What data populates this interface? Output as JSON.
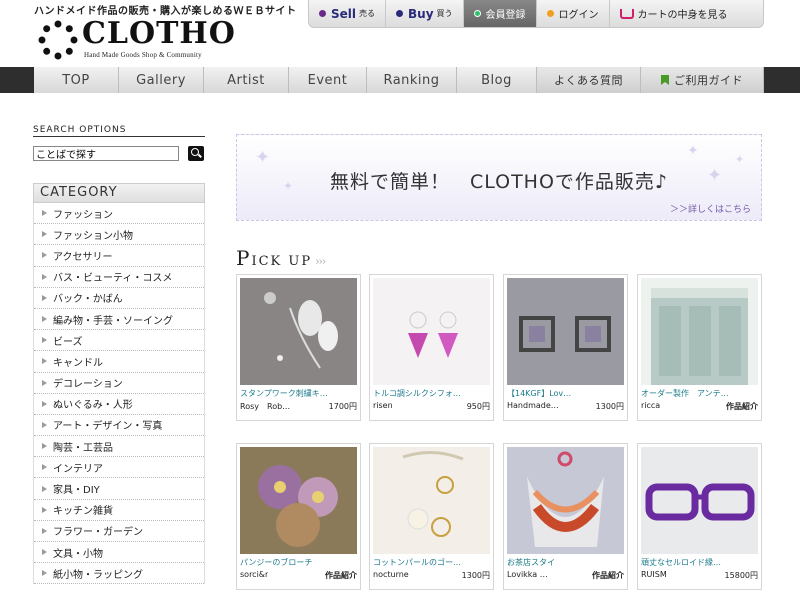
{
  "header": {
    "tagline": "ハンドメイド作品の販売・購入が楽しめるＷＥＢサイト",
    "logo_text": "CLOTHO",
    "logo_sub": "Hand Made Goods Shop & Community"
  },
  "topbar": {
    "sell_big": "Sell",
    "sell_small": "売る",
    "buy_big": "Buy",
    "buy_small": "買う",
    "register": "会員登録",
    "login": "ログイン",
    "cart": "カートの中身を見る"
  },
  "nav": {
    "items": [
      "TOP",
      "Gallery",
      "Artist",
      "Event",
      "Ranking",
      "Blog",
      "よくある質問",
      "ご利用ガイド"
    ]
  },
  "sidebar": {
    "search_title": "SEARCH OPTIONS",
    "search_value": "ことばで探す",
    "category_title": "CATEGORY",
    "categories": [
      "ファッション",
      "ファッション小物",
      "アクセサリー",
      "バス・ビューティ・コスメ",
      "バック・かばん",
      "編み物・手芸・ソーイング",
      "ビーズ",
      "キャンドル",
      "デコレーション",
      "ぬいぐるみ・人形",
      "アート・デザイン・写真",
      "陶芸・工芸品",
      "インテリア",
      "家具・DIY",
      "キッチン雑貨",
      "フラワー・ガーデン",
      "文具・小物",
      "紙小物・ラッピング"
    ]
  },
  "banner": {
    "text": "無料で簡単！　CLOTHOで作品販売♪",
    "link": "＞＞詳しくはこちら"
  },
  "pickup": {
    "title_big": "P",
    "title_rest": "ICK UP",
    "arrows": "›››",
    "products": [
      {
        "name": "スタンプワーク刺繍キ…",
        "shop": "Rosy　Rob…",
        "price": "1700円"
      },
      {
        "name": "トルコ調シルクシフォ…",
        "shop": "risen",
        "price": "950円"
      },
      {
        "name": "【14KGF】Lov…",
        "shop": "Handmade…",
        "price": "1300円"
      },
      {
        "name": "オーダー製作　アンテ…",
        "shop": "ricca",
        "price": "作品紹介"
      },
      {
        "name": "パンジーのブローチ",
        "shop": "sorci&r",
        "price": "作品紹介"
      },
      {
        "name": "コットンパールのゴー…",
        "shop": "nocturne",
        "price": "1300円"
      },
      {
        "name": "お茶店スタイ",
        "shop": "Lovikka …",
        "price": "作品紹介"
      },
      {
        "name": "頑丈なセルロイド縁…",
        "shop": "RUISM",
        "price": "15800円"
      }
    ]
  },
  "colors": {
    "nav_dark": "#2e2e2e",
    "product_link": "#1a7a8a",
    "banner_bg": "#ecebf8"
  }
}
